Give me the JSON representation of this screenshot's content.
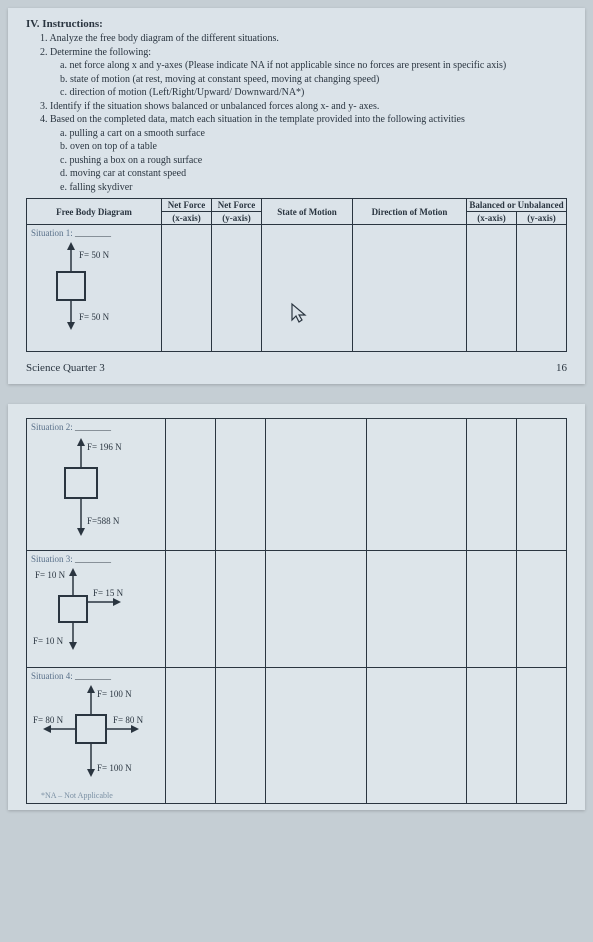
{
  "header": "IV.  Instructions:",
  "instructions": {
    "i1": "1. Analyze the free body diagram of the different situations.",
    "i2": "2. Determine the following:",
    "i2a": "a.  net force along x and y-axes (Please indicate NA if not applicable since no forces are present in specific axis)",
    "i2b": "b.  state of motion (at rest, moving at constant speed, moving at changing speed)",
    "i2c": "c.  direction of motion (Left/Right/Upward/ Downward/NA*)",
    "i3": "3. Identify if the situation shows balanced or unbalanced forces along x- and y- axes.",
    "i4": "4. Based on the completed data, match each situation in the template provided into the following activities",
    "i4a": "a.  pulling a cart on a smooth surface",
    "i4b": "b.  oven on top of a table",
    "i4c": "c.  pushing a box on a rough surface",
    "i4d": "d.  moving car at constant speed",
    "i4e": "e.  falling skydiver"
  },
  "table_headers": {
    "fbd": "Free Body Diagram",
    "nfx": "Net Force",
    "nfy": "Net Force",
    "xaxis": "(x-axis)",
    "yaxis": "(y-axis)",
    "state": "State of Motion",
    "dir": "Direction of Motion",
    "bal": "Balanced or Unbalanced",
    "balx": "(x-axis)",
    "baly": "(y-axis)"
  },
  "situations": {
    "s1": {
      "label": "Situation 1:",
      "top": "F= 50 N",
      "bottom": "F= 50 N"
    },
    "s2": {
      "label": "Situation 2:",
      "top": "F= 196 N",
      "bottom": "F=588 N"
    },
    "s3": {
      "label": "Situation 3:",
      "top": "F= 10 N",
      "right": "F= 15 N",
      "bottom": "F= 10 N"
    },
    "s4": {
      "label": "Situation 4:",
      "top": "F= 100 N",
      "left": "F= 80 N",
      "right": "F= 80 N",
      "bottom": "F= 100 N"
    }
  },
  "footer": {
    "left": "Science Quarter 3",
    "right": "16"
  },
  "na_note": "*NA – Not Applicable"
}
